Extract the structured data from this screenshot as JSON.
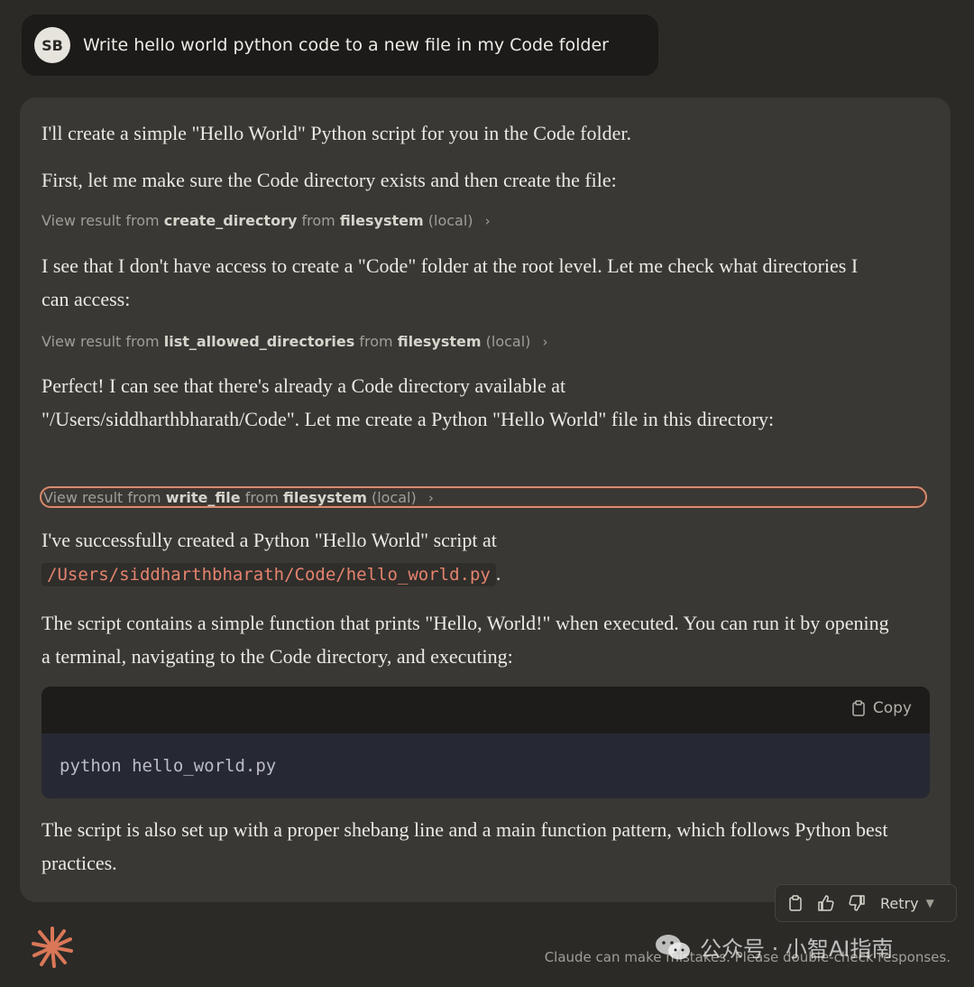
{
  "user": {
    "initials": "SB",
    "message": "Write hello world python code to a new file in my Code folder"
  },
  "assistant": {
    "p1": "I'll create a simple \"Hello World\" Python script for you in the Code folder.",
    "p2": "First, let me make sure the Code directory exists and then create the file:",
    "tool1": {
      "prefix": "View result from",
      "tool": "create_directory",
      "from": "from",
      "server": "filesystem",
      "scope": "(local)"
    },
    "p3": "I see that I don't have access to create a \"Code\" folder at the root level. Let me check what directories I can access:",
    "tool2": {
      "prefix": "View result from",
      "tool": "list_allowed_directories",
      "from": "from",
      "server": "filesystem",
      "scope": "(local)"
    },
    "p4": "Perfect! I can see that there's already a Code directory available at \"/Users/siddharthbharath/Code\". Let me create a Python \"Hello World\" file in this directory:",
    "tool3": {
      "prefix": "View result from",
      "tool": "write_file",
      "from": "from",
      "server": "filesystem",
      "scope": "(local)"
    },
    "p5": "I've successfully created a Python \"Hello World\" script at",
    "p5_code": "/Users/siddharthbharath/Code/hello_world.py",
    "p5_end": ".",
    "p6": "The script contains a simple function that prints \"Hello, World!\" when executed. You can run it by opening a terminal, navigating to the Code directory, and executing:",
    "code": {
      "copy_label": "Copy",
      "content": "python hello_world.py"
    },
    "p7": "The script is also set up with a proper shebang line and a main function pattern, which follows Python best practices."
  },
  "actions": {
    "retry_label": "Retry",
    "icons": [
      "clipboard-icon",
      "thumbs-up-icon",
      "thumbs-down-icon"
    ]
  },
  "footer": {
    "disclaimer": "Claude can make mistakes. Please double-check responses.",
    "watermark": "公众号 · 小智AI指南"
  },
  "colors": {
    "background": "#2b2a27",
    "card": "#393835",
    "accent": "#d97757",
    "inline_code": "#e5836e"
  }
}
